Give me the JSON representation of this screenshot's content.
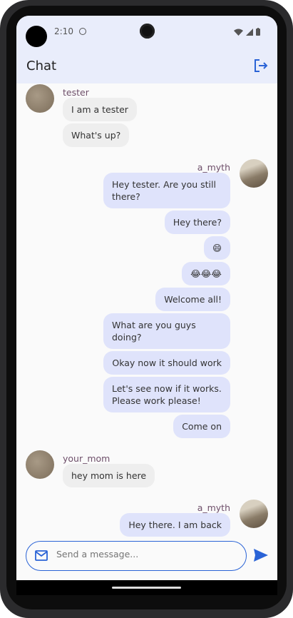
{
  "status_bar": {
    "time": "2:10"
  },
  "header": {
    "title": "Chat",
    "logout_icon": "logout-icon"
  },
  "messages": [
    {
      "side": "left",
      "user": "tester",
      "texts": [
        "I am a tester",
        "What's up?"
      ]
    },
    {
      "side": "right",
      "user": "a_myth",
      "texts": [
        "Hey tester. Are you still there?",
        "Hey there?",
        "😄",
        "😂😂😂",
        "Welcome all!",
        "What are you guys doing?",
        "Okay now it should work",
        "Let's see now if it works. Please work please!",
        "Come on"
      ]
    },
    {
      "side": "left",
      "user": "your_mom",
      "texts": [
        "hey mom is here"
      ]
    },
    {
      "side": "right",
      "user": "a_myth",
      "texts": [
        "Hey there. I am back"
      ]
    }
  ],
  "composer": {
    "placeholder": "Send a message...",
    "value": ""
  },
  "colors": {
    "accent": "#2a63d6",
    "header_bg": "#e9edfb",
    "sent_bubble": "#dfe3fb",
    "received_bubble": "#eeeeee",
    "username": "#6e4f6a"
  }
}
